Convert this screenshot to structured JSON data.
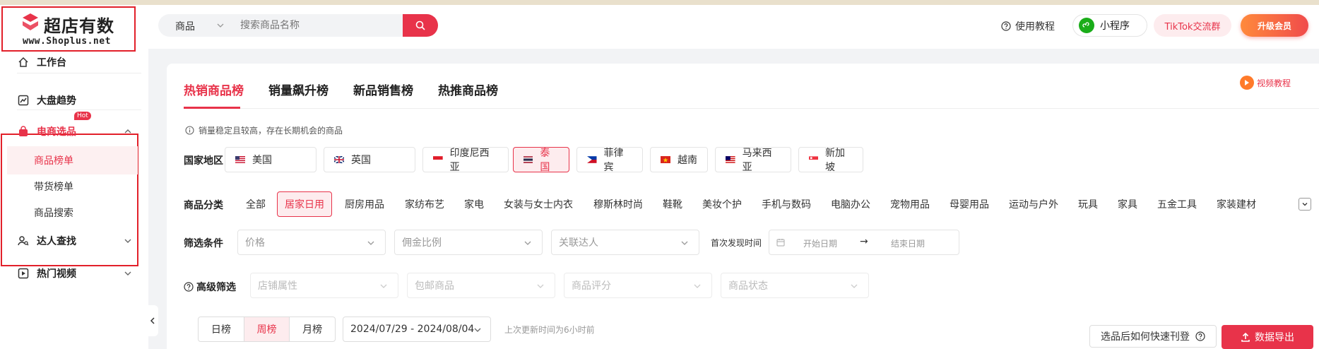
{
  "brand": {
    "name_cn": "超店有数",
    "name_en": "www.Shoplus.net"
  },
  "sidebar": {
    "items": [
      {
        "label": "工作台",
        "icon": "home-icon"
      },
      {
        "label": "大盘趋势",
        "icon": "trend-chart-icon"
      },
      {
        "label": "电商选品",
        "icon": "shopping-bag-icon",
        "badge": "Hot",
        "active": true,
        "sub": [
          {
            "label": "商品榜单",
            "active": true
          },
          {
            "label": "带货榜单"
          },
          {
            "label": "商品搜索"
          }
        ]
      },
      {
        "label": "达人查找",
        "icon": "user-search-icon"
      },
      {
        "label": "热门视频",
        "icon": "video-icon"
      }
    ]
  },
  "header": {
    "search": {
      "category": "商品",
      "placeholder": "搜索商品名称"
    },
    "help_label": "使用教程",
    "mini_program_label": "小程序",
    "tiktok_group_label": "TikTok交流群",
    "upgrade_label": "升级会员"
  },
  "tabs": [
    {
      "label": "热销商品榜",
      "active": true
    },
    {
      "label": "销量飙升榜"
    },
    {
      "label": "新品销售榜"
    },
    {
      "label": "热推商品榜"
    }
  ],
  "video_tutorial_label": "视频教程",
  "notice": "销量稳定且较高，存在长期机会的商品",
  "filters": {
    "country_label": "国家地区",
    "countries": [
      {
        "label": "美国",
        "flag": "us-flag-icon"
      },
      {
        "label": "英国",
        "flag": "uk-flag-icon"
      },
      {
        "label": "印度尼西亚",
        "flag": "id-flag-icon"
      },
      {
        "label": "泰国",
        "flag": "th-flag-icon",
        "active": true
      },
      {
        "label": "菲律宾",
        "flag": "ph-flag-icon"
      },
      {
        "label": "越南",
        "flag": "vn-flag-icon"
      },
      {
        "label": "马来西亚",
        "flag": "my-flag-icon"
      },
      {
        "label": "新加坡",
        "flag": "sg-flag-icon"
      }
    ],
    "category_label": "商品分类",
    "categories": [
      {
        "label": "全部"
      },
      {
        "label": "居家日用",
        "active": true
      },
      {
        "label": "厨房用品"
      },
      {
        "label": "家纺布艺"
      },
      {
        "label": "家电"
      },
      {
        "label": "女装与女士内衣"
      },
      {
        "label": "穆斯林时尚"
      },
      {
        "label": "鞋靴"
      },
      {
        "label": "美妆个护"
      },
      {
        "label": "手机与数码"
      },
      {
        "label": "电脑办公"
      },
      {
        "label": "宠物用品"
      },
      {
        "label": "母婴用品"
      },
      {
        "label": "运动与户外"
      },
      {
        "label": "玩具"
      },
      {
        "label": "家具"
      },
      {
        "label": "五金工具"
      },
      {
        "label": "家装建材"
      }
    ],
    "condition_label": "筛选条件",
    "conditions": [
      "价格",
      "佣金比例",
      "关联达人"
    ],
    "first_found_label": "首次发现时间",
    "date_start": "开始日期",
    "date_arrow": "→",
    "date_end": "结束日期",
    "advanced_label": "高级筛选",
    "advanced": [
      "店铺属性",
      "包邮商品",
      "商品评分",
      "商品状态"
    ]
  },
  "period": {
    "options": [
      {
        "label": "日榜"
      },
      {
        "label": "周榜",
        "active": true
      },
      {
        "label": "月榜"
      }
    ],
    "range": "2024/07/29 - 2024/08/04",
    "updated": "上次更新时间为6小时前"
  },
  "actions": {
    "howto_label": "选品后如何快速刊登",
    "export_label": "数据导出"
  },
  "colors": {
    "accent": "#e8334a",
    "upgrade_gradient_start": "#ff8a3c",
    "mini_program": "#1aad19"
  }
}
